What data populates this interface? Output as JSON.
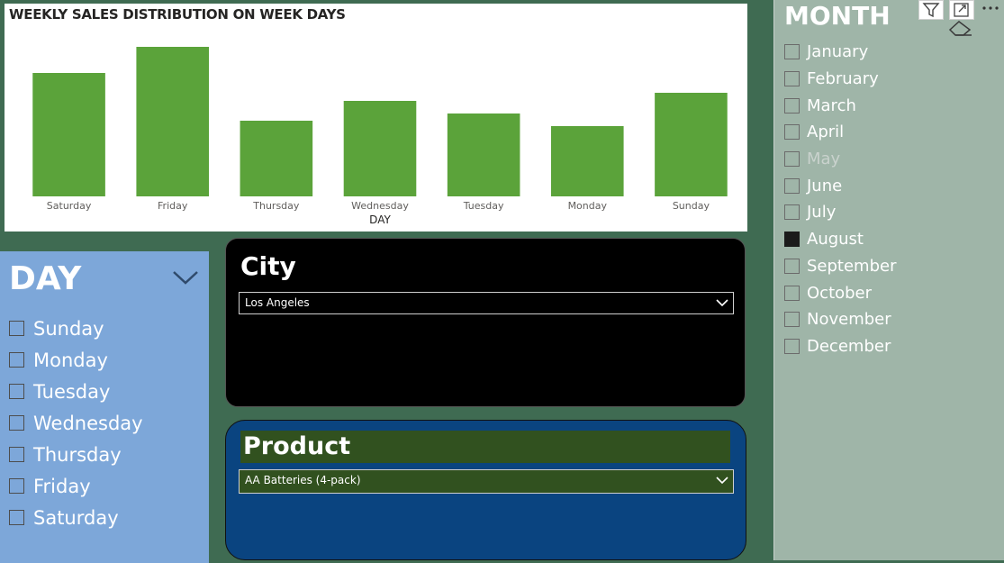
{
  "chart_data": {
    "type": "bar",
    "title": "WEEKLY SALES DISTRIBUTION ON WEEK DAYS",
    "xlabel": "DAY",
    "ylabel": "",
    "categories": [
      "Saturday",
      "Friday",
      "Thursday",
      "Wednesday",
      "Tuesday",
      "Monday",
      "Sunday"
    ],
    "values": [
      137,
      166,
      84,
      106,
      92,
      78,
      115
    ],
    "ylim": [
      0,
      175
    ],
    "bar_color": "#5ba33a",
    "grid": false,
    "legend": "none"
  },
  "day_slicer": {
    "title": "DAY",
    "items": [
      "Sunday",
      "Monday",
      "Tuesday",
      "Wednesday",
      "Thursday",
      "Friday",
      "Saturday"
    ]
  },
  "city_slicer": {
    "title": "City",
    "selected": "Los Angeles"
  },
  "product_slicer": {
    "title": "Product",
    "selected": "AA Batteries (4-pack)"
  },
  "month_slicer": {
    "title": "MONTH",
    "items": [
      {
        "label": "January",
        "checked": false,
        "dim": false
      },
      {
        "label": "February",
        "checked": false,
        "dim": false
      },
      {
        "label": "March",
        "checked": false,
        "dim": false
      },
      {
        "label": "April",
        "checked": false,
        "dim": false
      },
      {
        "label": "May",
        "checked": false,
        "dim": true
      },
      {
        "label": "June",
        "checked": false,
        "dim": false
      },
      {
        "label": "July",
        "checked": false,
        "dim": false
      },
      {
        "label": "August",
        "checked": true,
        "dim": false
      },
      {
        "label": "September",
        "checked": false,
        "dim": false
      },
      {
        "label": "October",
        "checked": false,
        "dim": false
      },
      {
        "label": "November",
        "checked": false,
        "dim": false
      },
      {
        "label": "December",
        "checked": false,
        "dim": false
      }
    ]
  },
  "colors": {
    "background": "#3f6b52",
    "day_panel": "#7da7d9",
    "product_panel": "#0a4480",
    "product_header": "#31511f",
    "month_panel": "#9fb5a8"
  },
  "icons": {
    "filter": "filter-icon",
    "focus": "focus-mode-icon",
    "more": "more-options-icon",
    "eraser": "clear-selections-icon",
    "chevron": "chevron-down-icon"
  }
}
